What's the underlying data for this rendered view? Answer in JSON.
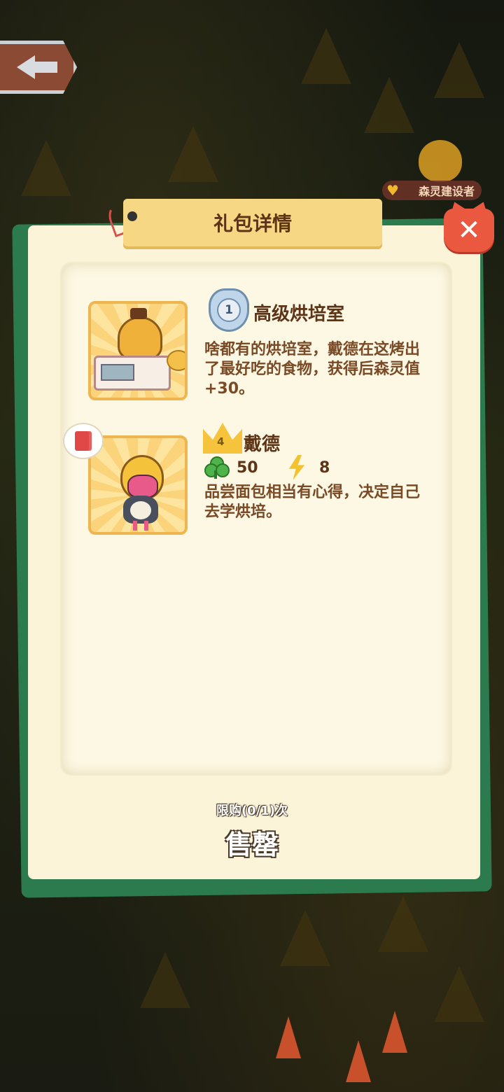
{
  "top": {
    "back_icon": "back-arrow-icon",
    "builder_badge": "森灵建设者"
  },
  "dialog": {
    "title": "礼包详情",
    "close_icon": "close-icon"
  },
  "items": [
    {
      "level": "1",
      "name": "高级烘培室",
      "description": "啥都有的烘培室，戴德在这烤出了最好吃的食物，获得后森灵值+30。"
    },
    {
      "level": "4",
      "name": "戴德",
      "stat_clover": "50",
      "stat_energy": "8",
      "description": "品尝面包相当有心得，决定自己去学烘培。"
    }
  ],
  "footer": {
    "limit": "限购(0/1)次",
    "status": "售罄"
  },
  "colors": {
    "panel": "#fbf4d8",
    "panel_shadow": "#2c7b4e",
    "title_tab": "#f6d784",
    "close": "#ea5840",
    "text_brown": "#5e3417"
  }
}
